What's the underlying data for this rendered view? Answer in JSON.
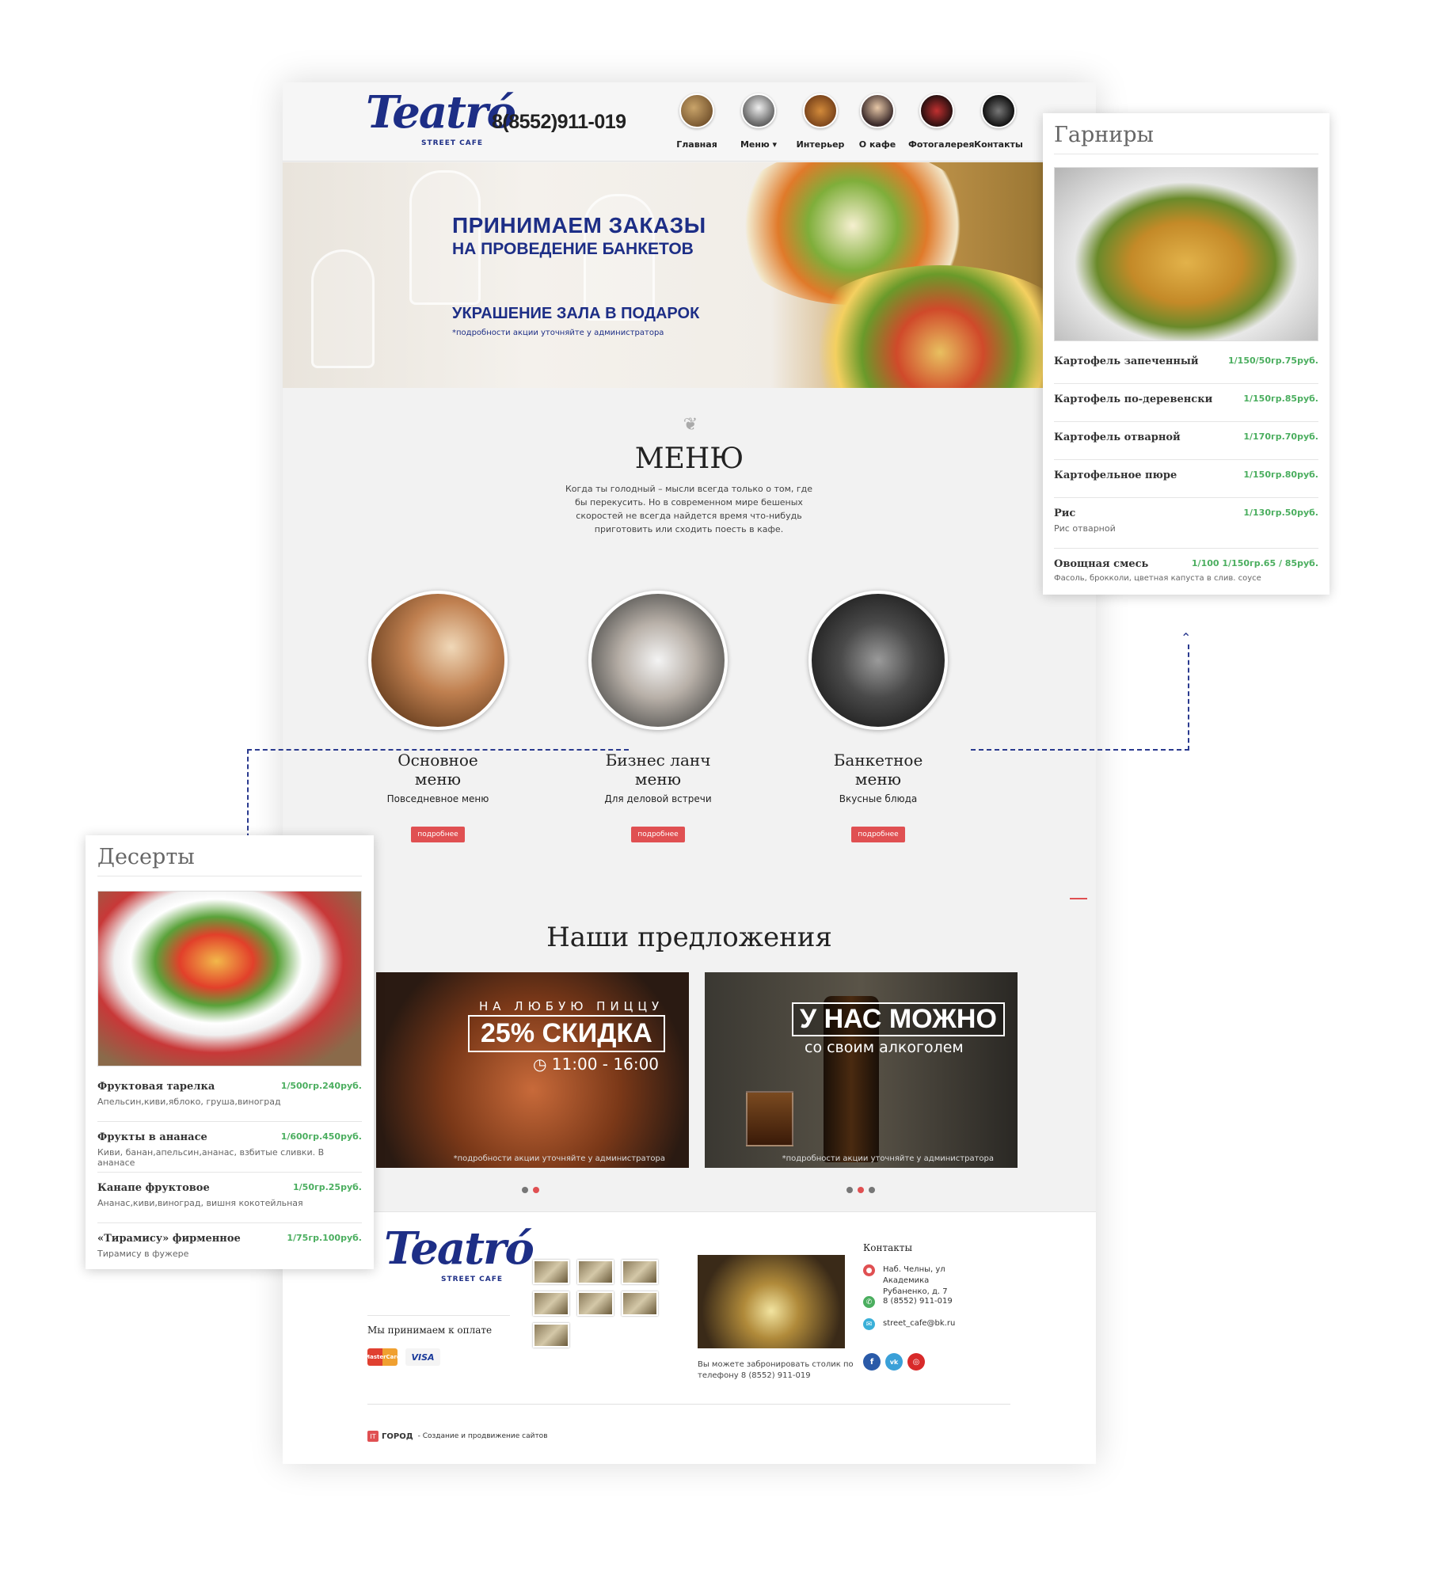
{
  "header": {
    "logo_main": "Teatró",
    "logo_sub": "STREET CAFE",
    "phone": "8(8552)911-019",
    "nav": [
      {
        "label": "Главная",
        "icon": "home-photo-icon"
      },
      {
        "label": "Меню ▾",
        "icon": "menu-photo-icon"
      },
      {
        "label": "Интерьер",
        "icon": "interior-photo-icon"
      },
      {
        "label": "О кафе",
        "icon": "about-photo-icon"
      },
      {
        "label": "Фотогалерея",
        "icon": "gallery-photo-icon"
      },
      {
        "label": "Контакты",
        "icon": "contacts-photo-icon"
      }
    ]
  },
  "banner": {
    "line1": "ПРИНИМАЕМ ЗАКАЗЫ",
    "line2": "НА ПРОВЕДЕНИЕ БАНКЕТОВ",
    "line3": "УКРАШЕНИЕ ЗАЛА В ПОДАРОК",
    "note": "*подробности акции уточняйте у администратора"
  },
  "menu": {
    "title": "МЕНЮ",
    "description": "Когда ты голодный – мысли всегда только о том, где бы перекусить. Но в современном мире бешеных скоростей не всегда найдется время что-нибудь приготовить или сходить поесть в кафе.",
    "categories": [
      {
        "title_line1": "Основное",
        "title_line2": "меню",
        "subtitle": "Повседневное меню",
        "button": "подробнее"
      },
      {
        "title_line1": "Бизнес ланч",
        "title_line2": "меню",
        "subtitle": "Для деловой встречи",
        "button": "подробнее"
      },
      {
        "title_line1": "Банкетное",
        "title_line2": "меню",
        "subtitle": "Вкусные блюда",
        "button": "подробнее"
      }
    ]
  },
  "offers": {
    "title": "Наши предложения",
    "pizza": {
      "top": "НА ЛЮБУЮ ПИЦЦУ",
      "main": "25% СКИДКА",
      "time": "◷ 11:00 - 16:00",
      "note": "*подробности акции уточняйте у администратора"
    },
    "alcohol": {
      "main": "У НАС МОЖНО",
      "sub": "со своим алкоголем",
      "note": "*подробности акции уточняйте у администратора"
    }
  },
  "footer": {
    "logo_main": "Teatró",
    "logo_sub": "STREET CAFE",
    "payment_label": "Мы принимаем к оплате",
    "payment_methods": [
      "MasterCard",
      "VISA"
    ],
    "booking_text": "Вы можете забронировать столик по телефону 8 (8552) 911-019",
    "contacts_title": "Контакты",
    "address": "Наб. Челны, ул Академика Рубаненко, д. 7",
    "phone": "8 (8552) 911-019",
    "email": "street_cafe@bk.ru",
    "social": [
      "f",
      "vk",
      "◎"
    ],
    "developer_logo": "ГОРОД",
    "developer_badge": "IT",
    "developer_text": "- Создание и продвижение сайтов"
  },
  "garnish_card": {
    "title": "Гарниры",
    "items": [
      {
        "name": "Картофель запеченный",
        "price": "1/150/50гр.75руб.",
        "desc": ""
      },
      {
        "name": "Картофель по-деревенски",
        "price": "1/150гр.85руб.",
        "desc": ""
      },
      {
        "name": "Картофель отварной",
        "price": "1/170гр.70руб.",
        "desc": ""
      },
      {
        "name": "Картофельное пюре",
        "price": "1/150гр.80руб.",
        "desc": ""
      },
      {
        "name": "Рис",
        "price": "1/130гр.50руб.",
        "desc": "Рис отварной"
      },
      {
        "name": "Овощная смесь",
        "price": "1/100 1/150гр.65 / 85руб.",
        "desc": "Фасоль, брокколи, цветная капуста в слив. соусе"
      }
    ]
  },
  "dessert_card": {
    "title": "Десерты",
    "items": [
      {
        "name": "Фруктовая тарелка",
        "price": "1/500гр.240руб.",
        "desc": "Апельсин,киви,яблоко, груша,виноград"
      },
      {
        "name": "Фрукты в ананасе",
        "price": "1/600гр.450руб.",
        "desc": "Киви, банан,апельсин,ананас, взбитые сливки. В ананасе"
      },
      {
        "name": "Канапе фруктовое",
        "price": "1/50гр.25руб.",
        "desc": "Ананас,киви,виноград, вишня кокотейльная"
      },
      {
        "name": "«Тирамису» фирменное",
        "price": "1/75гр.100руб.",
        "desc": "Тирамису в фужере"
      }
    ]
  },
  "colors": {
    "brand_blue": "#1d2e86",
    "accent_red": "#e05052",
    "price_green": "#4bae5f"
  }
}
